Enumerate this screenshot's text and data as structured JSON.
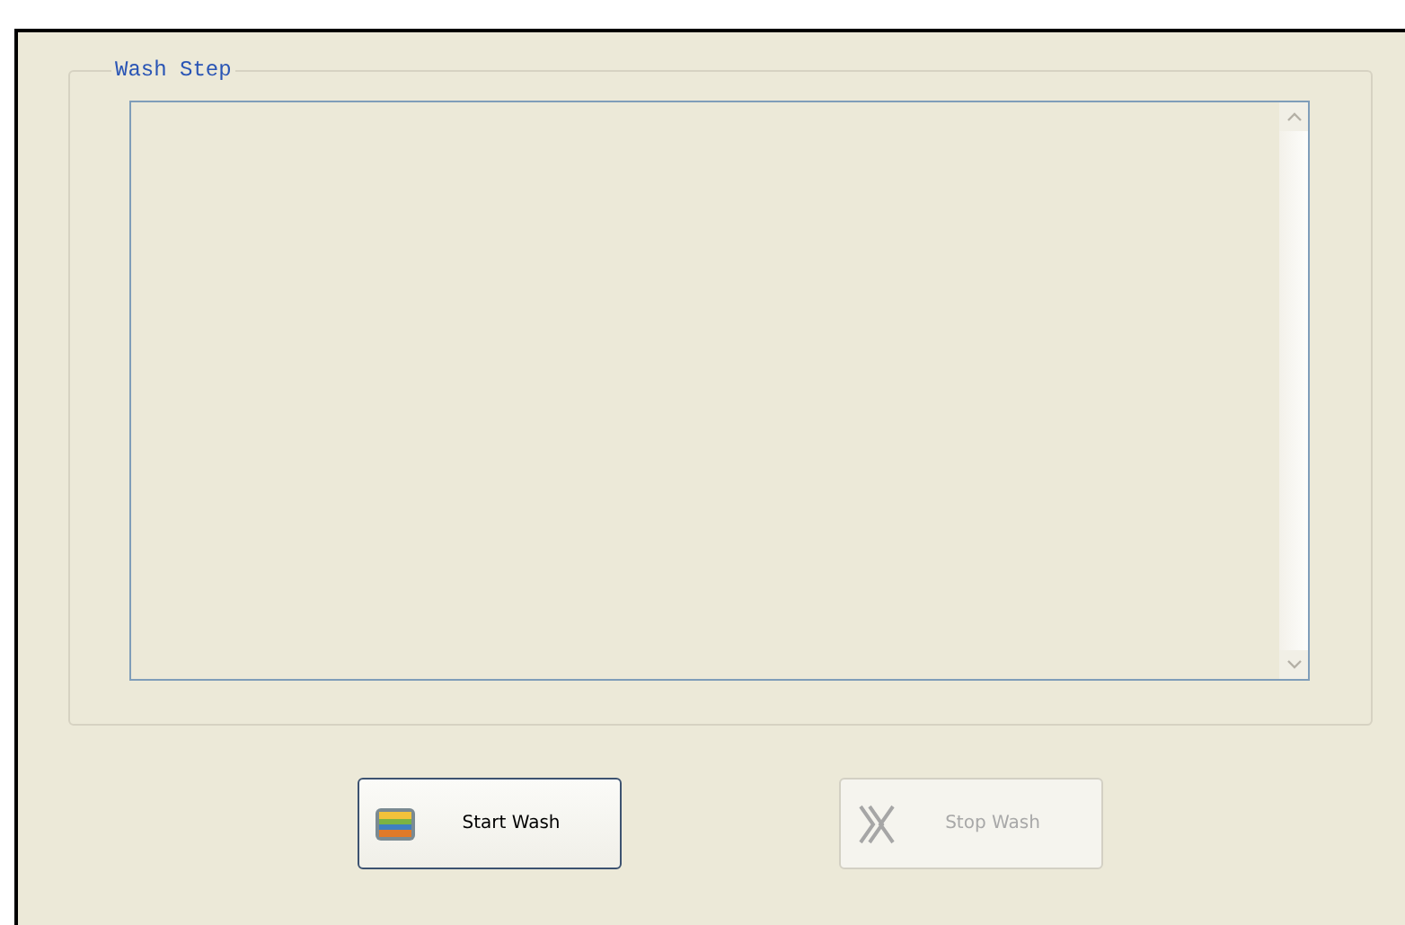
{
  "group": {
    "title": "Wash Step"
  },
  "buttons": [
    {
      "label": "Start Wash",
      "kind": "start",
      "disabled": false
    },
    {
      "label": "Stop Wash",
      "kind": "stop",
      "disabled": true
    }
  ]
}
